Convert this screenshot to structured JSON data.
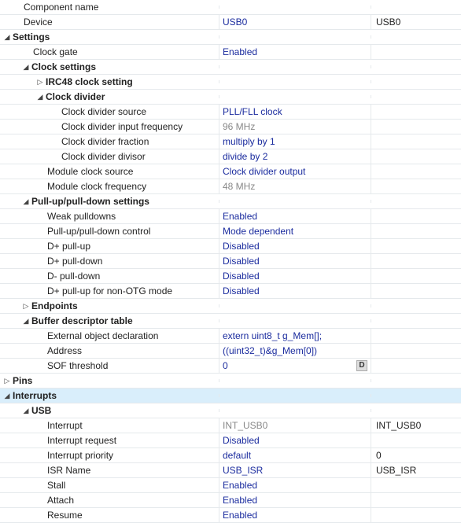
{
  "top": {
    "component_name": {
      "label": "Component name",
      "value": "",
      "extra": ""
    },
    "device": {
      "label": "Device",
      "value": "USB0",
      "extra": "USB0"
    }
  },
  "settings": {
    "label": "Settings",
    "clock_gate": {
      "label": "Clock gate",
      "value": "Enabled"
    },
    "clock_settings": {
      "label": "Clock settings",
      "irc48": {
        "label": "IRC48 clock setting"
      },
      "clock_divider": {
        "label": "Clock divider",
        "source": {
          "label": "Clock divider source",
          "value": "PLL/FLL clock"
        },
        "input_freq": {
          "label": "Clock divider input frequency",
          "value": "96 MHz"
        },
        "fraction": {
          "label": "Clock divider fraction",
          "value": "multiply by 1"
        },
        "divisor": {
          "label": "Clock divider divisor",
          "value": "divide by 2"
        }
      },
      "module_clock_source": {
        "label": "Module clock source",
        "value": "Clock divider output"
      },
      "module_clock_freq": {
        "label": "Module clock frequency",
        "value": "48 MHz"
      }
    },
    "pull": {
      "label": "Pull-up/pull-down settings",
      "weak": {
        "label": "Weak pulldowns",
        "value": "Enabled"
      },
      "control": {
        "label": "Pull-up/pull-down control",
        "value": "Mode dependent"
      },
      "dp_up": {
        "label": "D+ pull-up",
        "value": "Disabled"
      },
      "dp_dn": {
        "label": "D+ pull-down",
        "value": "Disabled"
      },
      "dm_dn": {
        "label": "D- pull-down",
        "value": "Disabled"
      },
      "dp_nonotg": {
        "label": "D+ pull-up for non-OTG mode",
        "value": "Disabled"
      }
    },
    "endpoints": {
      "label": "Endpoints"
    },
    "bdt": {
      "label": "Buffer descriptor table",
      "ext": {
        "label": "External object declaration",
        "value": "extern uint8_t g_Mem[];"
      },
      "addr": {
        "label": "Address",
        "value": "((uint32_t)&g_Mem[0])"
      },
      "sof": {
        "label": "SOF threshold",
        "value": "0",
        "icon": "D"
      }
    }
  },
  "pins": {
    "label": "Pins"
  },
  "interrupts": {
    "label": "Interrupts",
    "usb": {
      "label": "USB",
      "interrupt": {
        "label": "Interrupt",
        "value": "INT_USB0",
        "extra": "INT_USB0"
      },
      "request": {
        "label": "Interrupt request",
        "value": "Disabled"
      },
      "priority": {
        "label": "Interrupt priority",
        "value": "default",
        "extra": "0"
      },
      "isr": {
        "label": "ISR Name",
        "value": "USB_ISR",
        "extra": "USB_ISR"
      },
      "stall": {
        "label": "Stall",
        "value": "Enabled"
      },
      "attach": {
        "label": "Attach",
        "value": "Enabled"
      },
      "resume": {
        "label": "Resume",
        "value": "Enabled"
      }
    }
  },
  "glyphs": {
    "open": "◢",
    "closed": "▷"
  }
}
